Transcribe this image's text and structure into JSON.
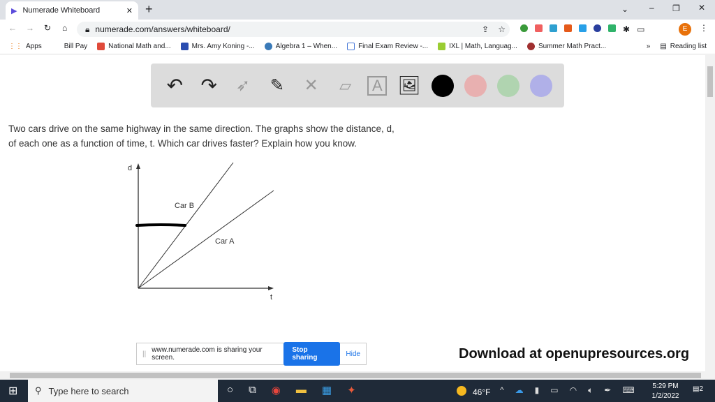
{
  "browser": {
    "tab_title": "Numerade Whiteboard",
    "url": "numerade.com/answers/whiteboard/",
    "bookmarks": [
      "Apps",
      "Bill Pay",
      "National Math and...",
      "Mrs. Amy Koning -...",
      "Algebra 1 – When...",
      "Final Exam Review -...",
      "IXL | Math, Languag...",
      "Summer Math Pract..."
    ],
    "reading_list": "Reading list",
    "profile": "E"
  },
  "toolbar": {
    "colors": [
      "#000000",
      "#e8b0b0",
      "#b0d4b0",
      "#b0b0e8"
    ]
  },
  "question": {
    "line1": "Two cars drive on the same highway in the same direction. The graphs show the distance, d,",
    "line2": "of each one as a function of time, t. Which car drives faster? Explain how you know."
  },
  "graph": {
    "y_label": "d",
    "x_label": "t",
    "car_b": "Car B",
    "car_a": "Car A"
  },
  "share": {
    "message": "www.numerade.com is sharing your screen.",
    "stop": "Stop sharing",
    "hide": "Hide"
  },
  "download": "Download at openupresources.org",
  "taskbar": {
    "search_placeholder": "Type here to search",
    "weather": "46°F",
    "time": "5:29 PM",
    "date": "1/2/2022",
    "notifications": "2"
  }
}
